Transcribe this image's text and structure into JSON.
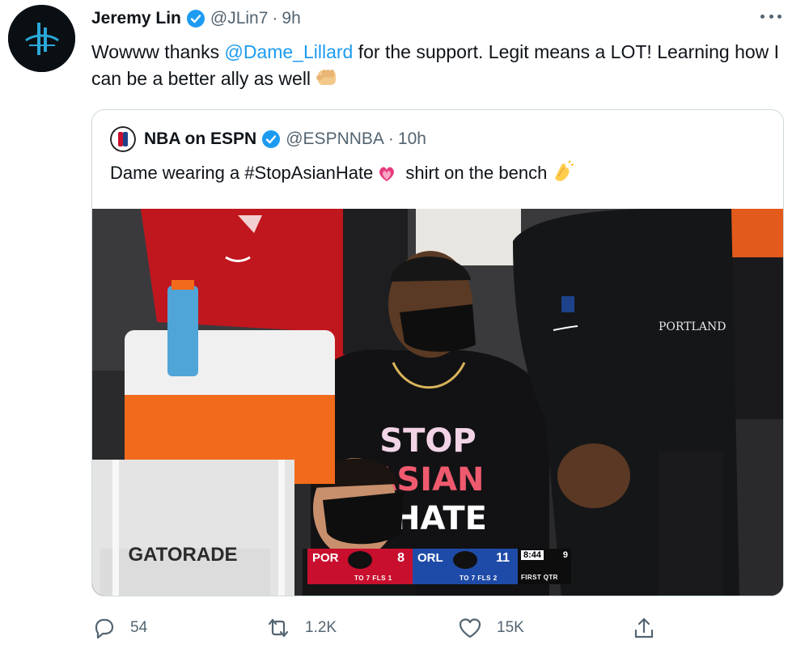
{
  "author": {
    "name": "Jeremy Lin",
    "handle": "@JLin7",
    "separator": "·",
    "time": "9h",
    "avatar_icon": "jl-logo-icon",
    "verified_icon": "verified-badge-icon"
  },
  "tweet": {
    "text_before": "Wowww thanks ",
    "mention": "@Dame_Lillard",
    "text_after": " for the support. Legit means a LOT! Learning how I can be a better ally as well",
    "emoji": "fist-bump-emoji"
  },
  "quoted_tweet": {
    "name": "NBA on ESPN",
    "handle": "@ESPNNBA",
    "separator": "·",
    "time": "10h",
    "text_before": "Dame wearing a #StopAsianHate",
    "text_middle": " shirt on the bench",
    "emoji_1": "heart-lotus-emoji",
    "emoji_2": "clapping-hands-emoji",
    "media": {
      "shirt_lines": [
        "STOP",
        "ASIAN",
        "HATE"
      ],
      "cooler_label": "GATORADE",
      "jacket_label": "PORTLAND",
      "scorebug": {
        "home_code": "POR",
        "home_score": "8",
        "home_sub": "TO 7   FLS 1",
        "away_code": "ORL",
        "away_score": "11",
        "away_sub": "TO 7   FLS 2",
        "clock": "8:44",
        "shot_clock": "9",
        "period": "FIRST QTR"
      }
    }
  },
  "actions": {
    "reply_count": "54",
    "retweet_count": "1.2K",
    "like_count": "15K",
    "reply_icon": "reply-icon",
    "retweet_icon": "retweet-icon",
    "like_icon": "heart-icon",
    "share_icon": "share-icon"
  },
  "colors": {
    "accent": "#1d9bf0",
    "secondary_text": "#536471",
    "border": "#cfd9de"
  }
}
